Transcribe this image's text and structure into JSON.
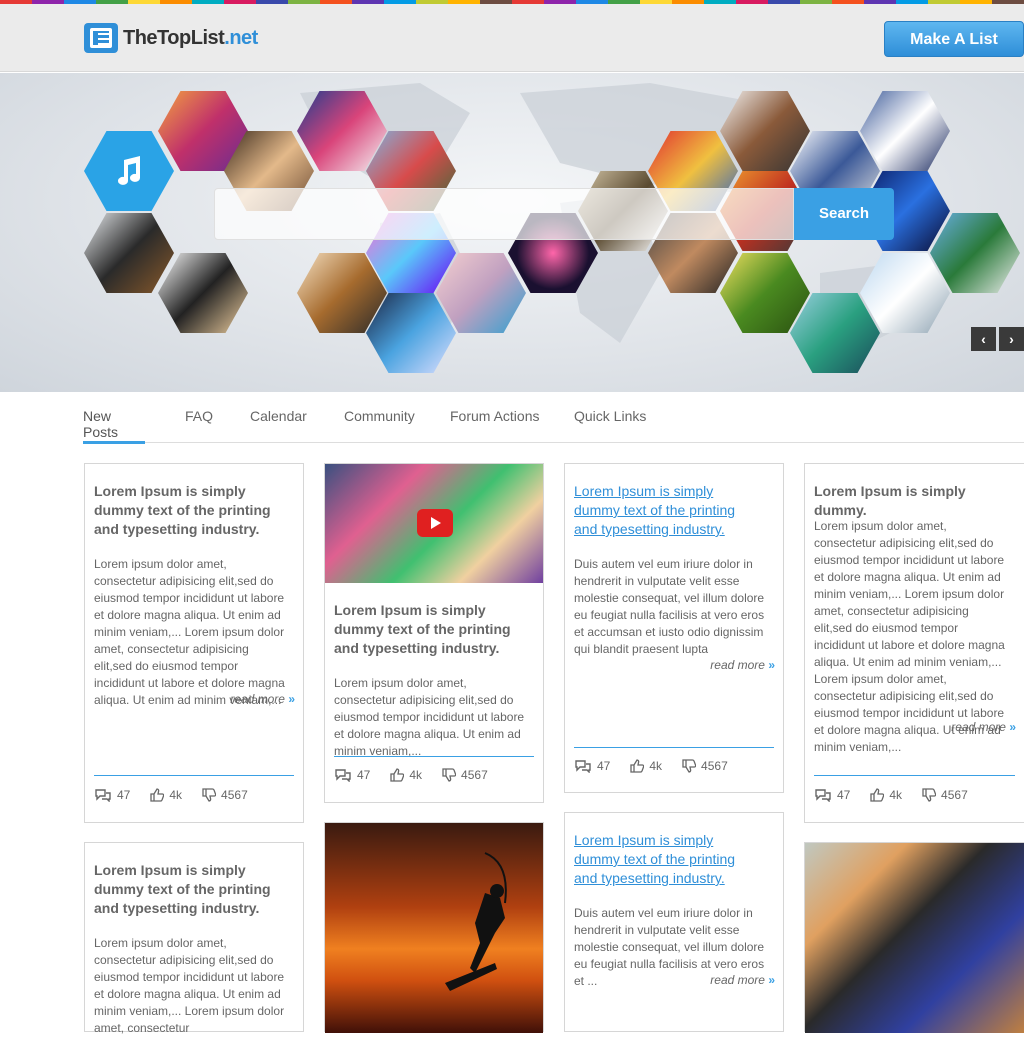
{
  "header": {
    "logo_main": "TheTopList",
    "logo_ext": ".net",
    "make_list_label": "Make A List"
  },
  "banner": {
    "search_placeholder": "",
    "search_label": "Search",
    "prev_arrow": "‹",
    "next_arrow": "›"
  },
  "tabs": [
    "New Posts",
    "FAQ",
    "Calendar",
    "Community",
    "Forum Actions",
    "Quick Links"
  ],
  "cards": [
    {
      "title": "Lorem Ipsum is simply dummy text of the printing and typesetting industry.",
      "body": "Lorem ipsum dolor amet, consectetur adipisicing elit,sed do eiusmod tempor incididunt ut labore et dolore magna aliqua. Ut enim ad minim veniam,... Lorem ipsum dolor amet, consectetur adipisicing elit,sed do eiusmod tempor incididunt ut labore et dolore magna aliqua. Ut enim ad minim veniam,...",
      "read_more": "read more",
      "comments": "47",
      "likes": "4k",
      "dislikes": "4567"
    },
    {
      "title": "Lorem Ipsum is simply dummy text of the printing and typesetting industry.",
      "body": "Lorem ipsum dolor amet, consectetur adipisicing elit,sed do eiusmod tempor incididunt ut labore et dolore magna aliqua. Ut enim ad minim veniam,...",
      "comments": "47",
      "likes": "4k",
      "dislikes": "4567"
    },
    {
      "title": "Lorem Ipsum is simply dummy text of the printing and typesetting industry.",
      "body": "Duis autem vel eum iriure dolor in hendrerit in vulputate velit esse molestie consequat, vel illum dolore eu feugiat nulla facilisis at vero eros et accumsan et iusto odio dignissim qui blandit praesent lupta",
      "read_more": "read more",
      "comments": "47",
      "likes": "4k",
      "dislikes": "4567"
    },
    {
      "title": "Lorem Ipsum is simply dummy.",
      "body": "Lorem ipsum dolor amet, consectetur adipisicing elit,sed do eiusmod tempor incididunt ut labore et dolore magna aliqua. Ut enim ad minim veniam,... Lorem ipsum dolor amet, consectetur adipisicing elit,sed do eiusmod tempor incididunt ut labore et dolore magna aliqua. Ut enim ad minim veniam,... Lorem ipsum dolor amet, consectetur adipisicing elit,sed do eiusmod tempor incididunt ut labore et dolore magna aliqua. Ut enim ad minim veniam,...",
      "read_more": "read more",
      "comments": "47",
      "likes": "4k",
      "dislikes": "4567"
    },
    {
      "title": "Lorem Ipsum is simply dummy text of the printing and typesetting industry.",
      "body": "Lorem ipsum dolor amet, consectetur adipisicing elit,sed do eiusmod tempor incididunt ut labore et dolore magna aliqua. Ut enim ad minim veniam,... Lorem ipsum dolor amet, consectetur"
    },
    {
      "title": "Lorem Ipsum is simply dummy text of the printing and typesetting industry.",
      "body": "Duis autem vel eum iriure dolor in hendrerit in vulputate velit esse molestie consequat, vel illum dolore eu feugiat nulla facilisis at vero eros et ...",
      "read_more": "read more"
    }
  ],
  "colors": {
    "accent": "#3aa0e4",
    "rainbow": [
      "#e53935",
      "#8e24aa",
      "#1e88e5",
      "#43a047",
      "#fdd835",
      "#fb8c00",
      "#00acc1",
      "#d81b60",
      "#3949ab",
      "#7cb342",
      "#f4511e",
      "#5e35b1",
      "#039be5",
      "#c0ca33",
      "#ffb300",
      "#6d4c41",
      "#e53935",
      "#8e24aa",
      "#1e88e5",
      "#43a047",
      "#fdd835",
      "#fb8c00",
      "#00acc1",
      "#d81b60",
      "#3949ab",
      "#7cb342",
      "#f4511e",
      "#5e35b1",
      "#039be5",
      "#c0ca33",
      "#ffb300",
      "#6d4c41"
    ]
  }
}
